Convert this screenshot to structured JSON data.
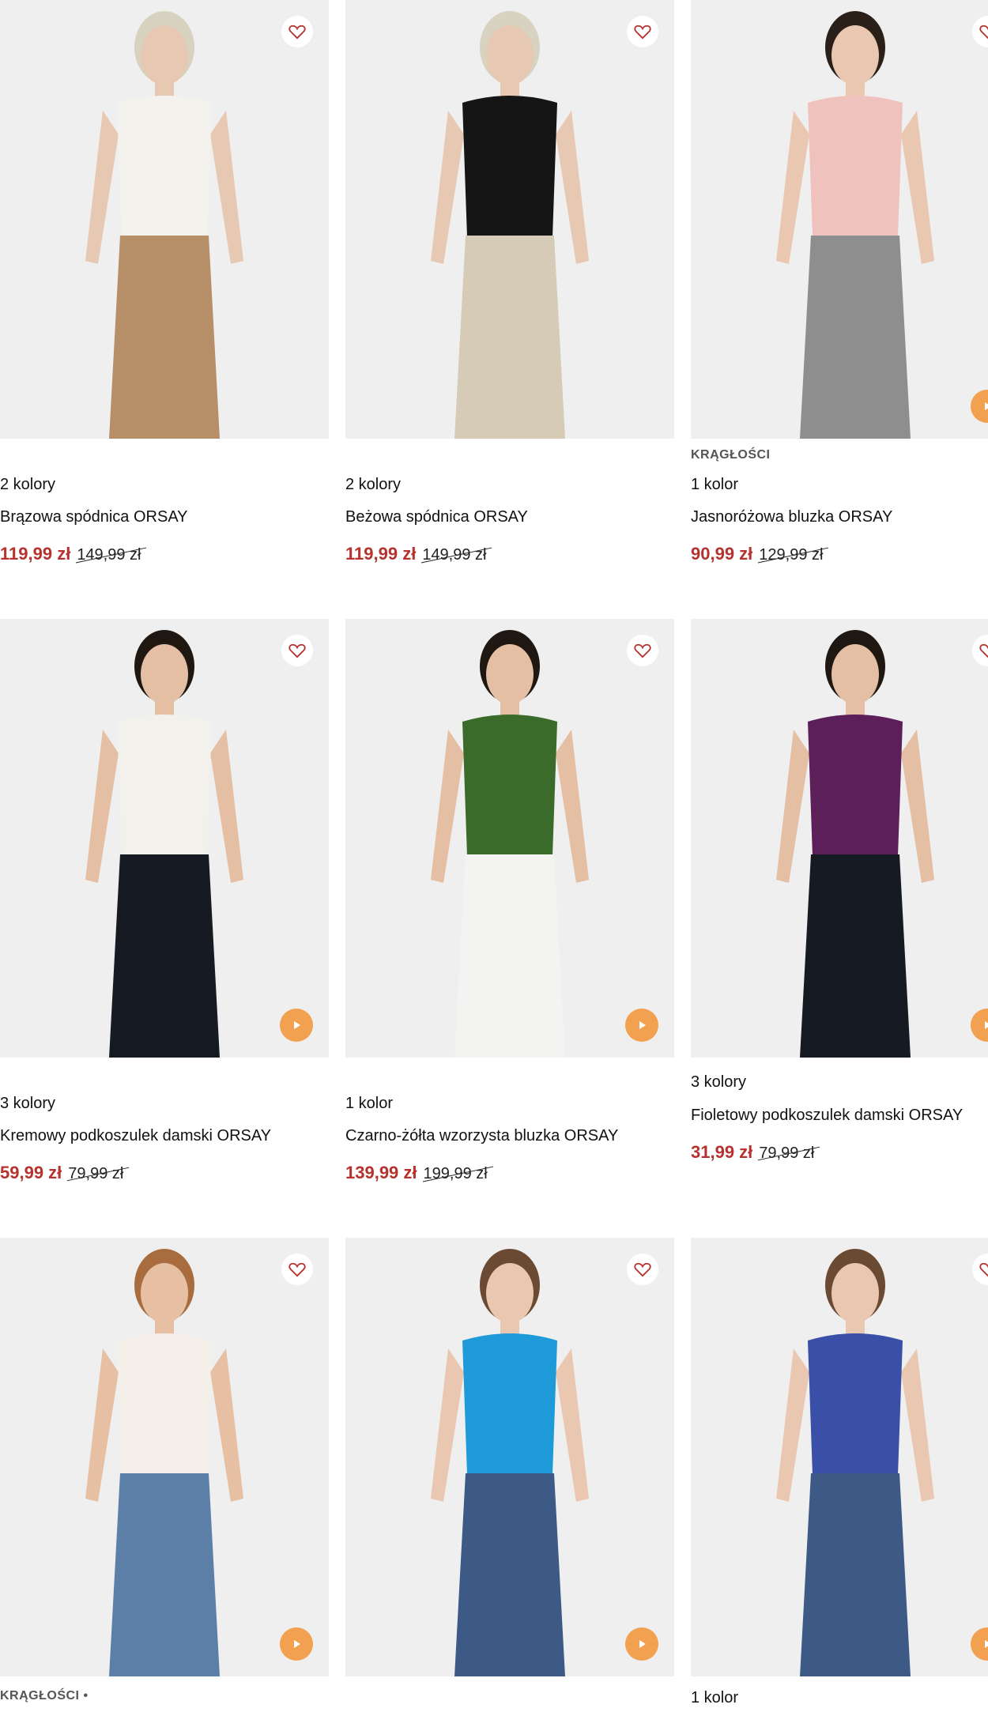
{
  "products": [
    {
      "tag": "",
      "colors": "2 kolory",
      "name": "Brązowa spódnica ORSAY",
      "price": "119,99 zł",
      "old_price": "149,99 zł",
      "video": false,
      "palette": {
        "top": "#f4f2ec",
        "bottom": "#b68e67",
        "skin": "#e7c8b2",
        "hair": "#d8d2c0"
      }
    },
    {
      "tag": "",
      "colors": "2 kolory",
      "name": "Beżowa spódnica ORSAY",
      "price": "119,99 zł",
      "old_price": "149,99 zł",
      "video": false,
      "palette": {
        "top": "#151515",
        "bottom": "#d6cbb6",
        "skin": "#e7c8b2",
        "hair": "#d8d2c0"
      }
    },
    {
      "tag": "KRĄGŁOŚCI",
      "colors": "1 kolor",
      "name": "Jasnoróżowa bluzka ORSAY",
      "price": "90,99 zł",
      "old_price": "129,99 zł",
      "video": true,
      "palette": {
        "top": "#f0c2bd",
        "bottom": "#8e8e8e",
        "skin": "#e9c7b0",
        "hair": "#2b2019"
      }
    },
    {
      "tag": "",
      "colors": "3 kolory",
      "name": "Kremowy podkoszulek damski ORSAY",
      "price": "59,99 zł",
      "old_price": "79,99 zł",
      "video": true,
      "palette": {
        "top": "#f3f1ec",
        "bottom": "#161a22",
        "skin": "#e4bfa4",
        "hair": "#1f1712"
      }
    },
    {
      "tag": "",
      "colors": "1 kolor",
      "name": "Czarno-żółta wzorzysta bluzka ORSAY",
      "price": "139,99 zł",
      "old_price": "199,99 zł",
      "video": true,
      "palette": {
        "top": "#3b6b2a",
        "bottom": "#f3f3f1",
        "skin": "#e4bfa4",
        "hair": "#1f1712"
      }
    },
    {
      "tag": "",
      "colors": "3 kolory",
      "name": "Fioletowy podkoszulek damski ORSAY",
      "price": "31,99 zł",
      "old_price": "79,99 zł",
      "video": true,
      "palette": {
        "top": "#5c1f5a",
        "bottom": "#161a22",
        "skin": "#e4bfa4",
        "hair": "#1f1712"
      }
    },
    {
      "tag": "KRĄGŁOŚCI •",
      "colors": "",
      "name": "",
      "price": "",
      "old_price": "",
      "video": true,
      "palette": {
        "top": "#f4efe8",
        "bottom": "#5b7fa6",
        "skin": "#e7c0a3",
        "hair": "#a86c3e"
      }
    },
    {
      "tag": "",
      "colors": "",
      "name": "",
      "price": "",
      "old_price": "",
      "video": true,
      "palette": {
        "top": "#1f9ad8",
        "bottom": "#3d5a86",
        "skin": "#e9c7b0",
        "hair": "#6b4a33"
      }
    },
    {
      "tag": "",
      "colors": "1 kolor",
      "name": "",
      "price": "",
      "old_price": "",
      "video": true,
      "palette": {
        "top": "#3a4fa8",
        "bottom": "#3d5a86",
        "skin": "#e9c7b0",
        "hair": "#6b4a33"
      }
    }
  ]
}
